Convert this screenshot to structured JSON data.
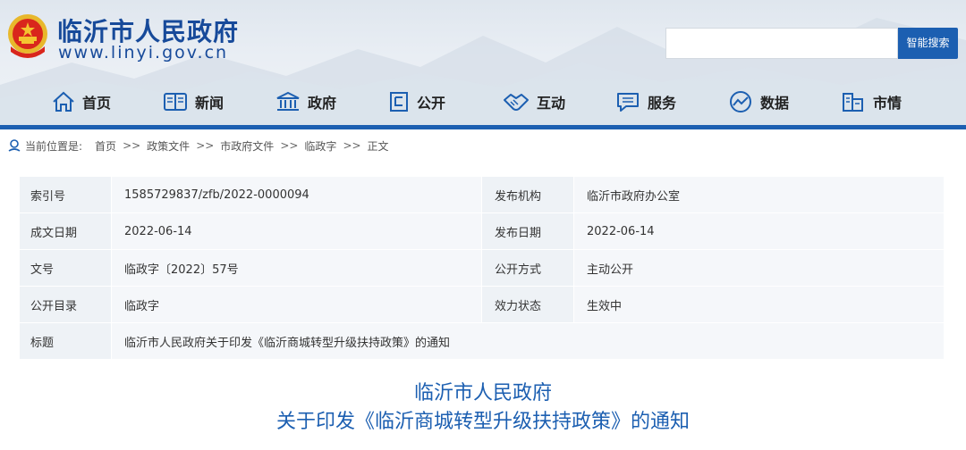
{
  "header": {
    "site_title": "临沂市人民政府",
    "site_url": "www.linyi.gov.cn",
    "search_placeholder": "",
    "search_button": "智能搜索"
  },
  "nav": [
    {
      "label": "首页",
      "icon": "home-icon"
    },
    {
      "label": "新闻",
      "icon": "book-icon"
    },
    {
      "label": "政府",
      "icon": "government-building-icon"
    },
    {
      "label": "公开",
      "icon": "notice-icon"
    },
    {
      "label": "互动",
      "icon": "handshake-icon"
    },
    {
      "label": "服务",
      "icon": "chat-service-icon"
    },
    {
      "label": "数据",
      "icon": "data-globe-icon"
    },
    {
      "label": "市情",
      "icon": "city-building-icon"
    }
  ],
  "breadcrumb": {
    "prefix": "当前位置是:",
    "items": [
      "首页",
      "政策文件",
      "市政府文件",
      "临政字",
      "正文"
    ],
    "separator": ">>"
  },
  "info": {
    "index_label": "索引号",
    "index_value": "1585729837/zfb/2022-0000094",
    "publisher_label": "发布机构",
    "publisher_value": "临沂市政府办公室",
    "written_date_label": "成文日期",
    "written_date_value": "2022-06-14",
    "publish_date_label": "发布日期",
    "publish_date_value": "2022-06-14",
    "doc_no_label": "文号",
    "doc_no_value": "临政字〔2022〕57号",
    "open_mode_label": "公开方式",
    "open_mode_value": "主动公开",
    "catalog_label": "公开目录",
    "catalog_value": "临政字",
    "status_label": "效力状态",
    "status_value": "生效中",
    "title_label": "标题",
    "title_value": "临沂市人民政府关于印发《临沂商城转型升级扶持政策》的通知"
  },
  "document": {
    "title_line1": "临沂市人民政府",
    "title_line2": "关于印发《临沂商城转型升级扶持政策》的通知"
  },
  "colors": {
    "brand_blue": "#1c5fb1",
    "title_blue": "#174a9a",
    "label_bg": "#eef2f6",
    "value_bg": "#f5f7fa"
  }
}
